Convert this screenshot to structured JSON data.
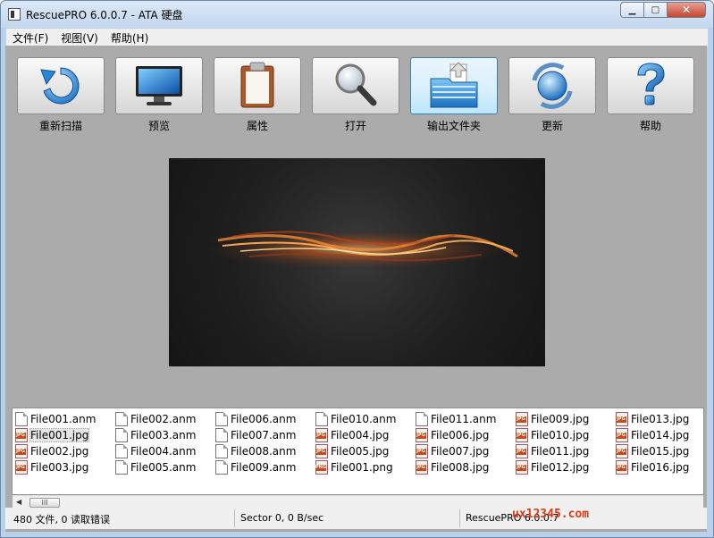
{
  "window": {
    "title": "RescuePRO 6.0.0.7 - ATA 硬盘",
    "controls": {
      "minimize": "▁",
      "maximize": "□",
      "close": "✕"
    }
  },
  "menu": [
    "文件(F)",
    "视图(V)",
    "帮助(H)"
  ],
  "toolbar": [
    {
      "label": "重新扫描",
      "icon": "rescan-icon"
    },
    {
      "label": "预览",
      "icon": "monitor-icon"
    },
    {
      "label": "属性",
      "icon": "clipboard-icon"
    },
    {
      "label": "打开",
      "icon": "magnifier-icon"
    },
    {
      "label": "输出文件夹",
      "icon": "folder-export-icon",
      "active": true
    },
    {
      "label": "更新",
      "icon": "update-globe-icon"
    },
    {
      "label": "帮助",
      "icon": "help-icon"
    }
  ],
  "files": [
    [
      "File001.anm",
      "File001.jpg",
      "File002.jpg",
      "File003.jpg"
    ],
    [
      "File002.anm",
      "File003.anm",
      "File004.anm",
      "File005.anm"
    ],
    [
      "File006.anm",
      "File007.anm",
      "File008.anm",
      "File009.anm"
    ],
    [
      "File010.anm",
      "File004.jpg",
      "File005.jpg",
      "File001.png"
    ],
    [
      "File011.anm",
      "File006.jpg",
      "File007.jpg",
      "File008.jpg"
    ],
    [
      "File009.jpg",
      "File010.jpg",
      "File011.jpg",
      "File012.jpg"
    ],
    [
      "File013.jpg",
      "File014.jpg",
      "File015.jpg",
      "File016.jpg"
    ]
  ],
  "selected_file": "File001.jpg",
  "scroll_thumb": "III",
  "status": {
    "files": "480 文件, 0 读取错误",
    "sector": "Sector 0, 0 B/sec",
    "app": "RescuePRO 6.0.0.7"
  },
  "watermark": "ux12345.com"
}
